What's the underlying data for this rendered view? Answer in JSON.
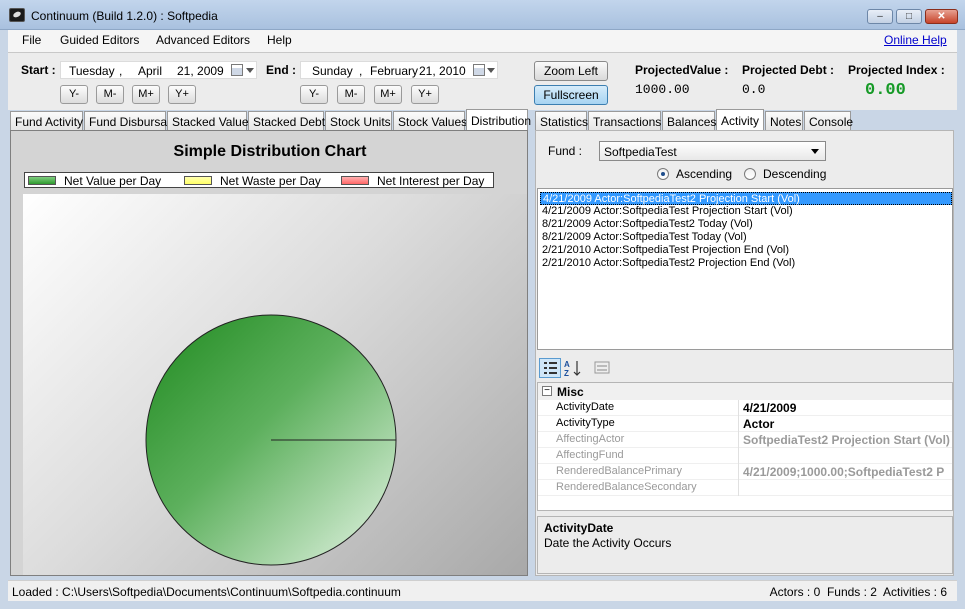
{
  "window": {
    "title": "Continuum (Build 1.2.0) : Softpedia",
    "controls": {
      "minimize": "‒",
      "maximize": "□",
      "close": "✕"
    }
  },
  "menu": {
    "items": [
      "File",
      "Guided Editors",
      "Advanced Editors",
      "Help"
    ],
    "online_help": "Online Help"
  },
  "toolbar": {
    "start_label": "Start :",
    "start_date": {
      "weekday": "Tuesday",
      "month": "April",
      "day_year": "21, 2009"
    },
    "end_label": "End :",
    "end_date": {
      "weekday": "Sunday",
      "month": "February",
      "day_year": "21, 2010"
    },
    "comma": ",",
    "adjust_buttons": [
      "Y-",
      "M-",
      "M+",
      "Y+"
    ],
    "zoom_left": "Zoom Left",
    "fullscreen": "Fullscreen",
    "projected_value_label": "ProjectedValue :",
    "projected_value": "1000.00",
    "projected_debt_label": "Projected Debt :",
    "projected_debt": "0.0",
    "projected_index_label": "Projected Index :",
    "projected_index": "0.00"
  },
  "left_tabs": [
    "Fund Activity",
    "Fund Disbursal",
    "Stacked Value",
    "Stacked Debt",
    "Stock Units",
    "Stock Values",
    "Distribution"
  ],
  "left_active_tab": "Distribution",
  "chart_data": {
    "type": "pie",
    "title": "Simple Distribution Chart",
    "series": [
      {
        "name": "Net Value per Day",
        "value": 100,
        "color": "#2f9a2f"
      },
      {
        "name": "Net Waste per Day",
        "value": 0,
        "color": "#ffff66"
      },
      {
        "name": "Net Interest per Day",
        "value": 0,
        "color": "#ff6666"
      }
    ],
    "legend_position": "top"
  },
  "right_tabs": [
    "Statistics",
    "Transactions",
    "Balances",
    "Activity",
    "Notes",
    "Console"
  ],
  "right_active_tab": "Activity",
  "activity": {
    "fund_label": "Fund :",
    "fund_value": "SoftpediaTest",
    "ascending_label": "Ascending",
    "descending_label": "Descending",
    "sort": "Ascending",
    "items": [
      "4/21/2009 Actor:SoftpediaTest2 Projection Start (Vol)",
      "4/21/2009 Actor:SoftpediaTest Projection Start (Vol)",
      "8/21/2009 Actor:SoftpediaTest2 Today (Vol)",
      "8/21/2009 Actor:SoftpediaTest Today (Vol)",
      "2/21/2010 Actor:SoftpediaTest Projection End (Vol)",
      "2/21/2010 Actor:SoftpediaTest2 Projection End (Vol)"
    ],
    "selected_index": 0
  },
  "properties": {
    "tool_icons": [
      "categorized-icon",
      "alphabetical-icon",
      "property-pages-icon"
    ],
    "category": "Misc",
    "collapse": "−",
    "rows": [
      {
        "name": "ActivityDate",
        "value": "4/21/2009",
        "enabled": true
      },
      {
        "name": "ActivityType",
        "value": "Actor",
        "enabled": true
      },
      {
        "name": "AffectingActor",
        "value": "SoftpediaTest2 Projection Start (Vol)",
        "enabled": false
      },
      {
        "name": "AffectingFund",
        "value": "",
        "enabled": false
      },
      {
        "name": "RenderedBalancePrimary",
        "value": "4/21/2009;1000.00;SoftpediaTest2 P",
        "enabled": false
      },
      {
        "name": "RenderedBalanceSecondary",
        "value": "",
        "enabled": false
      }
    ],
    "description_title": "ActivityDate",
    "description_text": "Date the Activity Occurs"
  },
  "status": {
    "loaded": "Loaded : C:\\Users\\Softpedia\\Documents\\Continuum\\Softpedia.continuum",
    "counts": "Actors : 0  Funds : 2  Activities : 6"
  }
}
